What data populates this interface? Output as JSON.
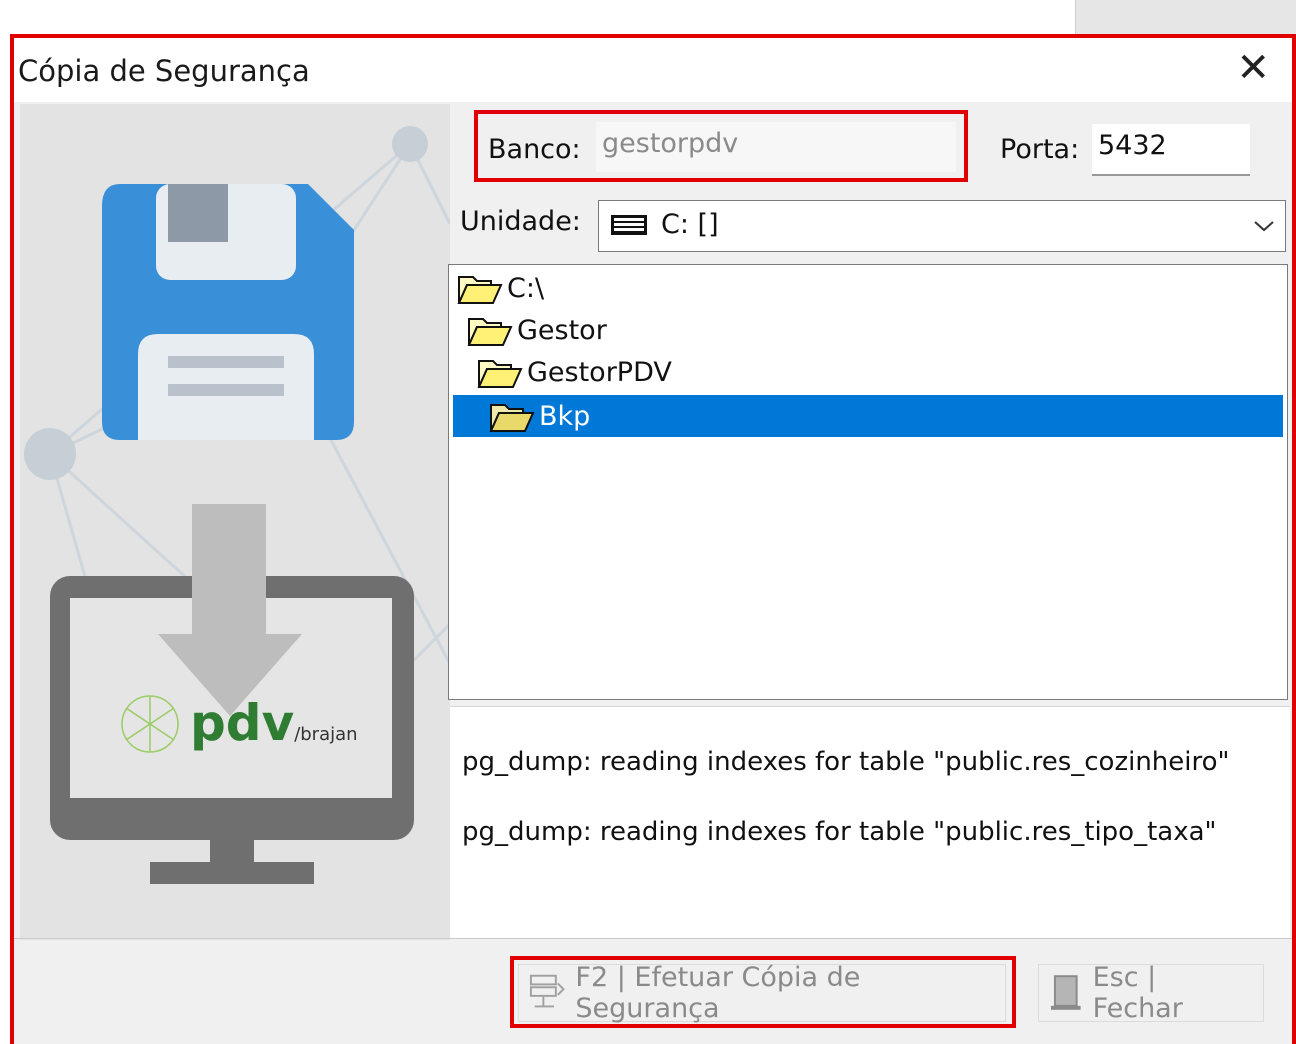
{
  "window": {
    "title": "Cópia de Segurança",
    "close_glyph": "✕"
  },
  "form": {
    "banco_label": "Banco:",
    "banco_value": "gestorpdv",
    "porta_label": "Porta:",
    "porta_value": "5432",
    "unidade_label": "Unidade:",
    "unidade_value": "C: []"
  },
  "tree": {
    "items": [
      {
        "label": "C:\\",
        "icon": "folder-open-icon"
      },
      {
        "label": "Gestor",
        "icon": "folder-open-icon"
      },
      {
        "label": "GestorPDV",
        "icon": "folder-open-icon"
      },
      {
        "label": "Bkp",
        "icon": "folder-open-icon",
        "selected": true
      }
    ]
  },
  "log": [
    "pg_dump: reading indexes for table \"public.res_cozinheiro\"",
    "pg_dump: reading indexes for table \"public.res_tipo_taxa\""
  ],
  "buttons": {
    "backup": "F2 | Efetuar Cópia de Segurança",
    "close": "Esc | Fechar"
  },
  "logo": {
    "text": "pdv",
    "subtext": "/brajan"
  },
  "colors": {
    "highlight": "#e00000",
    "selection": "#0078d7",
    "floppy": "#3a8fd9",
    "monitor": "#6f6f6f",
    "logo_green": "#2e7d32"
  }
}
